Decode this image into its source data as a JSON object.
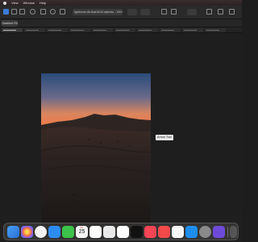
{
  "menubar": {
    "items": [
      "View",
      "Window",
      "Help"
    ]
  },
  "toolbar": {
    "document_path": "lightroom-lib-final 8x10.afphoto - 100.0% (RGBA/8) - 300 x 400 px"
  },
  "context": {
    "label": "Gradient Fill"
  },
  "tabs": {
    "count": 10,
    "active_index": 0
  },
  "canvas": {
    "tooltip": "Arrow Tool"
  },
  "dock": {
    "calendar": {
      "month": "JUL",
      "day": "25"
    }
  },
  "colors": {
    "accent": "#3a7bd5",
    "sky_top": "#2a4b7a",
    "sky_glow": "#f07a4a",
    "dune": "#2a2220"
  }
}
